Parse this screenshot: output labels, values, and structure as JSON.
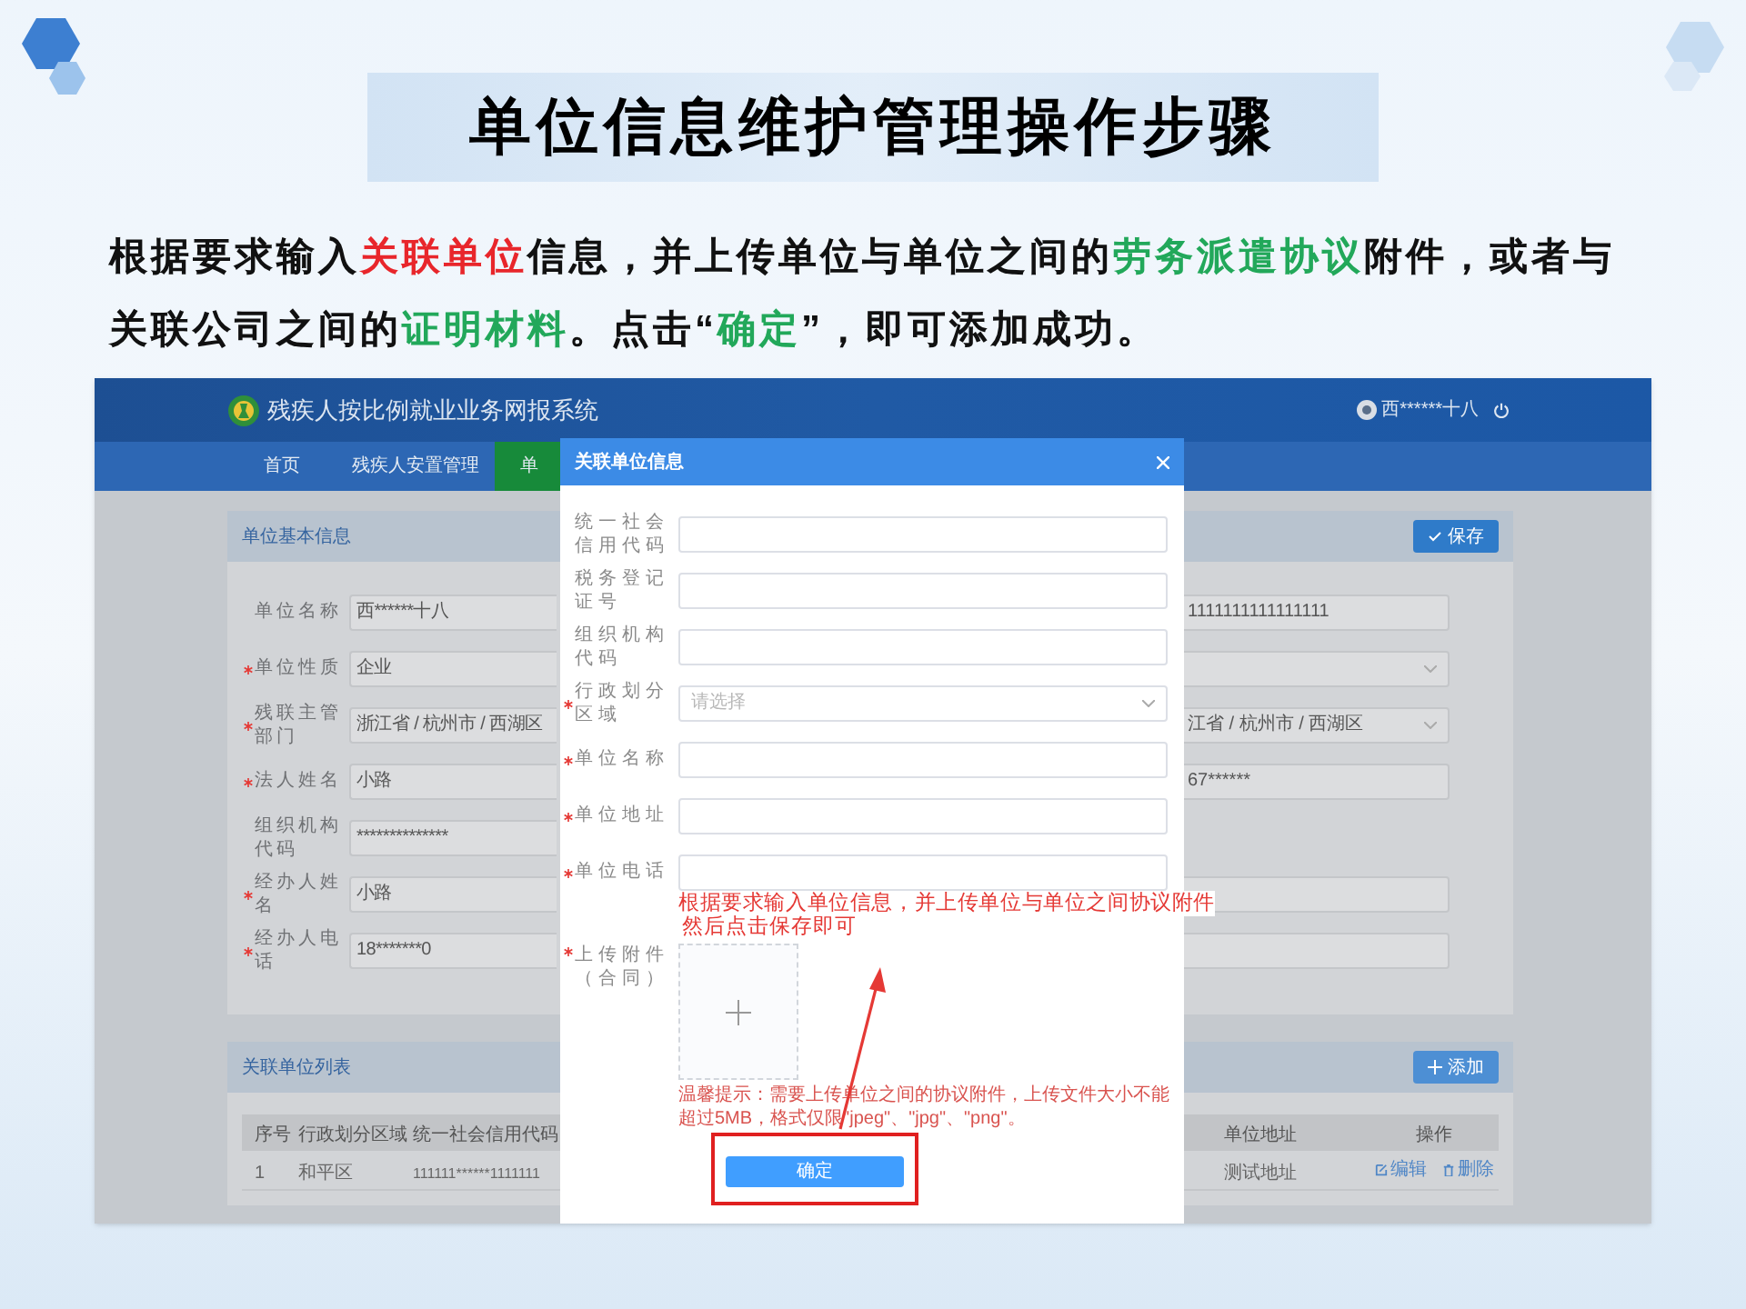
{
  "slide": {
    "title": "单位信息维护管理操作步骤",
    "description": [
      {
        "text": "根据要求输入"
      },
      {
        "text": "关联单位",
        "color": "#e8262b"
      },
      {
        "text": "信息，并上传单位与单位之间的"
      },
      {
        "text": "劳务派遣协议",
        "color": "#22a85a"
      },
      {
        "text": "附件，或者与关联公司之间的"
      },
      {
        "text": "证明材料",
        "color": "#22a85a"
      },
      {
        "text": "。点击“"
      },
      {
        "text": "确定",
        "color": "#22a85a"
      },
      {
        "text": "”，即可添加成功。"
      }
    ]
  },
  "app": {
    "title": "残疾人按比例就业业务网报系统",
    "user": "西******十八",
    "nav": [
      {
        "label": "首页",
        "selected": false
      },
      {
        "label": "残疾人安置管理",
        "selected": false
      },
      {
        "label": "单",
        "selected": true
      }
    ],
    "basic_info": {
      "title": "单位基本信息",
      "save_button": "保存",
      "fields": [
        {
          "label": "单位名称",
          "required": false,
          "value": "西******十八"
        },
        {
          "label": "单位性质",
          "required": true,
          "value": "企业"
        },
        {
          "label": "残联主管部门",
          "required": true,
          "value": "浙江省 / 杭州市 / 西湖区"
        },
        {
          "label": "法人姓名",
          "required": true,
          "value": "小路"
        },
        {
          "label": "组织机构代码",
          "required": false,
          "value": "**************"
        },
        {
          "label": "经办人姓名",
          "required": true,
          "value": "小路"
        },
        {
          "label": "经办人电话",
          "required": true,
          "value": "18*******0"
        }
      ],
      "right_fields": [
        {
          "kind": "input",
          "value": "1111111111111111"
        },
        {
          "kind": "select"
        },
        {
          "kind": "select",
          "value": "江省 / 杭州市 / 西湖区"
        },
        {
          "kind": "input",
          "value": "67******"
        },
        {
          "kind": "none"
        },
        {
          "kind": "input"
        },
        {
          "kind": "input"
        }
      ]
    },
    "related_list": {
      "title": "关联单位列表",
      "add_button": "添加",
      "columns": [
        "序号",
        "行政划分区域",
        "统一社会信用代码",
        "单位地址",
        "操作"
      ],
      "rows": [
        {
          "cells": [
            "1",
            "和平区",
            "111111******1111111",
            "测试地址"
          ],
          "actions": [
            "编辑",
            "删除"
          ]
        }
      ]
    }
  },
  "dialog": {
    "title": "关联单位信息",
    "fields": [
      {
        "label": "统一社会信用代码",
        "required": false,
        "kind": "input"
      },
      {
        "label": "税务登记证号",
        "required": false,
        "kind": "input"
      },
      {
        "label": "组织机构代码",
        "required": false,
        "kind": "input"
      },
      {
        "label": "行政划分区域",
        "required": true,
        "kind": "select",
        "placeholder": "请选择"
      },
      {
        "label": "单位名称",
        "required": true,
        "kind": "input"
      },
      {
        "label": "单位地址",
        "required": true,
        "kind": "input"
      },
      {
        "label": "单位电话",
        "required": true,
        "kind": "input"
      }
    ],
    "upload": {
      "label": "上传附件（合同）",
      "required": true
    },
    "hint": "温馨提示：需要上传单位之间的协议附件，上传文件大小不能超过5MB，格式仅限\"jpeg\"、\"jpg\"、\"png\"。",
    "confirm_button": "确定"
  },
  "annotations": [
    "根据要求输入单位信息，并上传单位与单位之间协议附件",
    "然后点击保存即可"
  ]
}
